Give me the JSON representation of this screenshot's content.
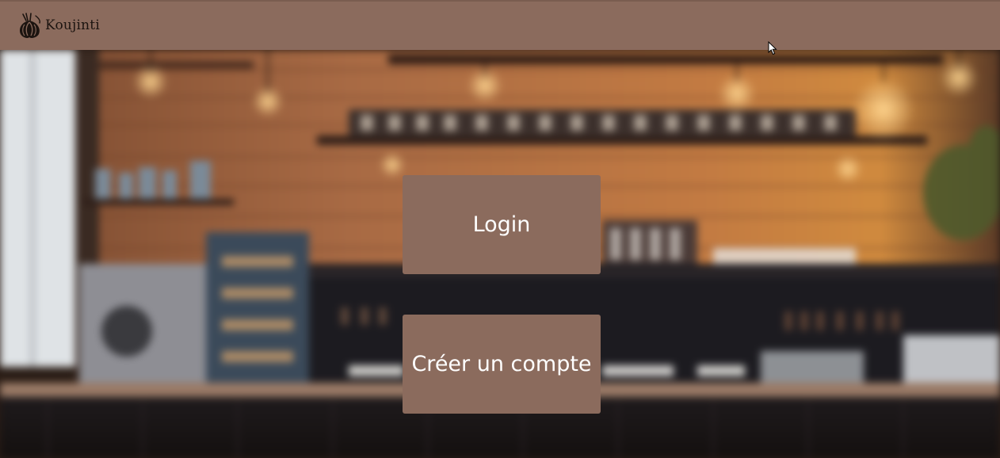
{
  "header": {
    "brand_name": "Koujinti",
    "logo_icon": "garlic-bulb-logo-icon",
    "background_color": "#8b6b5d"
  },
  "actions": {
    "login_label": "Login",
    "register_label": "Créer un compte",
    "button_color": "#8b6b5d",
    "text_color": "#ffffff"
  },
  "background": {
    "image": "blurred-cafe-interior-photo"
  }
}
